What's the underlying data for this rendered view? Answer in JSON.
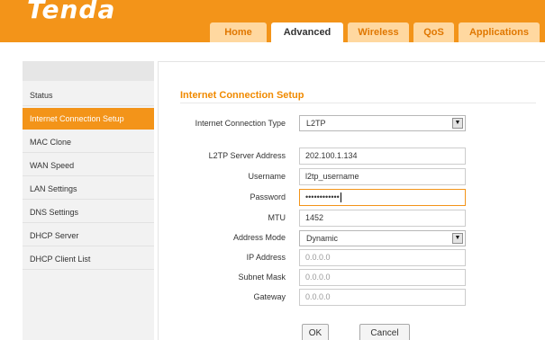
{
  "brand": {
    "logo_text": "Tenda"
  },
  "tabs": [
    {
      "label": "Home"
    },
    {
      "label": "Advanced"
    },
    {
      "label": "Wireless"
    },
    {
      "label": "QoS"
    },
    {
      "label": "Applications"
    }
  ],
  "sidebar": {
    "items": [
      {
        "label": "Status"
      },
      {
        "label": "Internet Connection Setup"
      },
      {
        "label": "MAC Clone"
      },
      {
        "label": "WAN Speed"
      },
      {
        "label": "LAN Settings"
      },
      {
        "label": "DNS Settings"
      },
      {
        "label": "DHCP Server"
      },
      {
        "label": "DHCP Client List"
      }
    ]
  },
  "form": {
    "title": "Internet Connection Setup",
    "connection_type": {
      "label": "Internet Connection Type",
      "value": "L2TP"
    },
    "server_address": {
      "label": "L2TP Server Address",
      "value": "202.100.1.134"
    },
    "username": {
      "label": "Username",
      "value": "l2tp_username"
    },
    "password": {
      "label": "Password",
      "value": "••••••••••••"
    },
    "mtu": {
      "label": "MTU",
      "value": "1452"
    },
    "address_mode": {
      "label": "Address Mode",
      "value": "Dynamic"
    },
    "ip_address": {
      "label": "IP Address",
      "value": "0.0.0.0"
    },
    "subnet_mask": {
      "label": "Subnet Mask",
      "value": "0.0.0.0"
    },
    "gateway": {
      "label": "Gateway",
      "value": "0.0.0.0"
    }
  },
  "buttons": {
    "ok": "OK",
    "cancel": "Cancel"
  },
  "colors": {
    "accent": "#f39419",
    "title": "#f08a00",
    "tab_inactive_bg": "#ffd8a0"
  }
}
